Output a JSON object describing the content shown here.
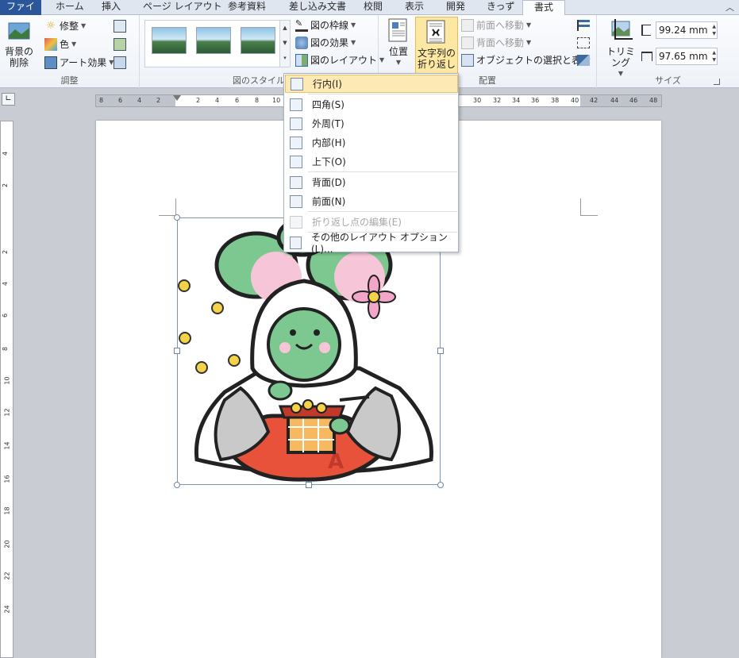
{
  "tabs": [
    {
      "label": "ファイル"
    },
    {
      "label": "ホーム"
    },
    {
      "label": "挿入"
    },
    {
      "label": "ページ レイアウト"
    },
    {
      "label": "参考資料"
    },
    {
      "label": "差し込み文書"
    },
    {
      "label": "校閲"
    },
    {
      "label": "表示"
    },
    {
      "label": "開発"
    },
    {
      "label": "きっず"
    },
    {
      "label": "書式"
    }
  ],
  "ribbon": {
    "adjust": {
      "remove_bg": "背景の削除",
      "corrections": "修整",
      "color": "色",
      "art_effects": "アート効果",
      "label": "調整"
    },
    "styles": {
      "border": "図の枠線",
      "effects": "図の効果",
      "layout": "図のレイアウト",
      "label": "図のスタイル"
    },
    "arrange": {
      "position": "位置",
      "wrap_line1": "文字列の",
      "wrap_line2": "折り返し",
      "bring_forward": "前面へ移動",
      "send_backward": "背面へ移動",
      "selection_pane": "オブジェクトの選択と表示",
      "label": "配置"
    },
    "size": {
      "crop": "トリミング",
      "height": "99.24 mm",
      "width": "97.65 mm",
      "label": "サイズ"
    }
  },
  "ruler": {
    "h_ticks": [
      "8",
      "6",
      "4",
      "2",
      "2",
      "4",
      "6",
      "8",
      "10",
      "30",
      "32",
      "34",
      "36",
      "38",
      "40",
      "42",
      "44",
      "46",
      "48"
    ],
    "v_ticks": [
      "4",
      "2",
      "2",
      "4",
      "6",
      "8",
      "10",
      "12",
      "14",
      "16",
      "18",
      "20",
      "22",
      "24"
    ]
  },
  "menu": {
    "items": [
      {
        "label": "行内(I)"
      },
      {
        "label": "四角(S)"
      },
      {
        "label": "外周(T)"
      },
      {
        "label": "内部(H)"
      },
      {
        "label": "上下(O)"
      },
      {
        "label": "背面(D)"
      },
      {
        "label": "前面(N)"
      },
      {
        "label": "折り返し点の編集(E)"
      },
      {
        "label": "その他のレイアウト オプション(L)..."
      }
    ]
  },
  "colors": {
    "file_tab": "#2b579a",
    "highlight": "#fde9b4",
    "char_green": "#7dc891",
    "char_red": "#e8523a"
  }
}
